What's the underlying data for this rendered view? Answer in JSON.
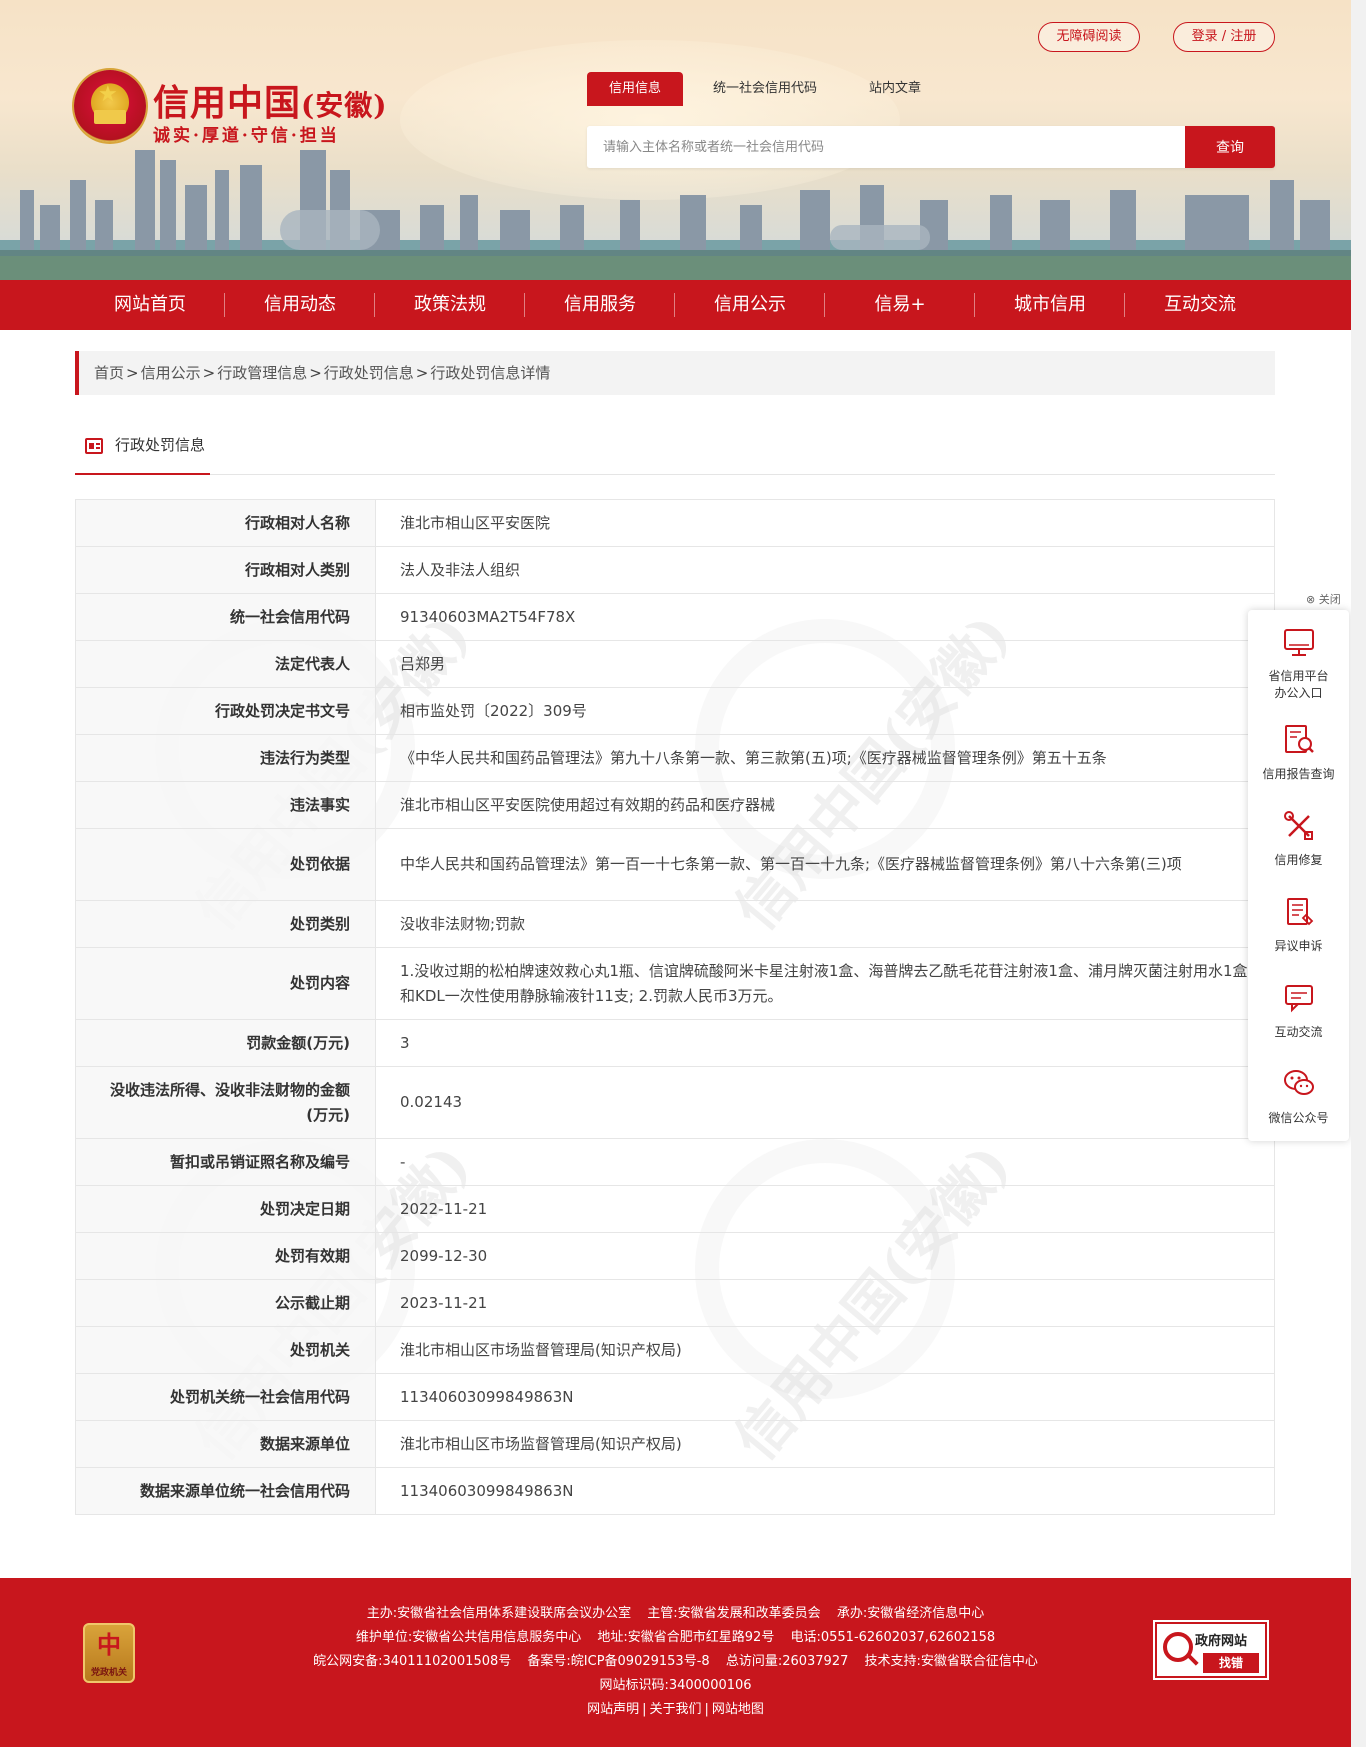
{
  "header": {
    "logo_title": "信用中国",
    "logo_province": "(安徽)",
    "logo_slogan": "诚实·厚道·守信·担当",
    "accessibility_label": "无障碍阅读",
    "login_label": "登录 / 注册",
    "search_tabs": [
      {
        "label": "信用信息",
        "active": true
      },
      {
        "label": "统一社会信用代码",
        "active": false
      },
      {
        "label": "站内文章",
        "active": false
      }
    ],
    "search_placeholder": "请输入主体名称或者统一社会信用代码",
    "search_button": "查询"
  },
  "nav": {
    "items": [
      "网站首页",
      "信用动态",
      "政策法规",
      "信用服务",
      "信用公示",
      "信易+",
      "城市信用",
      "互动交流"
    ]
  },
  "breadcrumb": {
    "items": [
      "首页",
      "信用公示",
      "行政管理信息",
      "行政处罚信息",
      "行政处罚信息详情"
    ],
    "separator": ">"
  },
  "section": {
    "title": "行政处罚信息"
  },
  "watermark": {
    "text": "信用中国(安徽)"
  },
  "detail_rows": [
    {
      "label": "行政相对人名称",
      "value": "淮北市相山区平安医院"
    },
    {
      "label": "行政相对人类别",
      "value": "法人及非法人组织"
    },
    {
      "label": "统一社会信用代码",
      "value": "91340603MA2T54F78X"
    },
    {
      "label": "法定代表人",
      "value": "吕郑男"
    },
    {
      "label": "行政处罚决定书文号",
      "value": "相市监处罚〔2022〕309号"
    },
    {
      "label": "违法行为类型",
      "value": "《中华人民共和国药品管理法》第九十八条第一款、第三款第(五)项;《医疗器械监督管理条例》第五十五条"
    },
    {
      "label": "违法事实",
      "value": "淮北市相山区平安医院使用超过有效期的药品和医疗器械"
    },
    {
      "label": "处罚依据",
      "value": "中华人民共和国药品管理法》第一百一十七条第一款、第一百一十九条;《医疗器械监督管理条例》第八十六条第(三)项"
    },
    {
      "label": "处罚类别",
      "value": "没收非法财物;罚款"
    },
    {
      "label": "处罚内容",
      "value": "1.没收过期的松柏牌速效救心丸1瓶、信谊牌硫酸阿米卡星注射液1盒、海普牌去乙酰毛花苷注射液1盒、浦月牌灭菌注射用水1盒和KDL一次性使用静脉输液针11支; 2.罚款人民币3万元。"
    },
    {
      "label": "罚款金额(万元)",
      "value": "3"
    },
    {
      "label": "没收违法所得、没收非法财物的金额(万元)",
      "value": "0.02143"
    },
    {
      "label": "暂扣或吊销证照名称及编号",
      "value": "-"
    },
    {
      "label": "处罚决定日期",
      "value": "2022-11-21"
    },
    {
      "label": "处罚有效期",
      "value": "2099-12-30"
    },
    {
      "label": "公示截止期",
      "value": "2023-11-21"
    },
    {
      "label": "处罚机关",
      "value": "淮北市相山区市场监督管理局(知识产权局)"
    },
    {
      "label": "处罚机关统一社会信用代码",
      "value": "11340603099849863N"
    },
    {
      "label": "数据来源单位",
      "value": "淮北市相山区市场监督管理局(知识产权局)"
    },
    {
      "label": "数据来源单位统一社会信用代码",
      "value": "11340603099849863N"
    }
  ],
  "side_panel": {
    "close_label": "⊗ 关闭",
    "items": [
      {
        "label": "省信用平台办公入口",
        "icon": "monitor-icon"
      },
      {
        "label": "信用报告查询",
        "icon": "report-search-icon"
      },
      {
        "label": "信用修复",
        "icon": "tools-icon"
      },
      {
        "label": "异议申诉",
        "icon": "appeal-document-icon"
      },
      {
        "label": "互动交流",
        "icon": "chat-icon"
      },
      {
        "label": "微信公众号",
        "icon": "wechat-icon"
      }
    ]
  },
  "footer": {
    "badge_text": "党政机关",
    "line1": [
      "主办:安徽省社会信用体系建设联席会议办公室",
      "主管:安徽省发展和改革委员会",
      "承办:安徽省经济信息中心"
    ],
    "line2": [
      "维护单位:安徽省公共信用信息服务中心",
      "地址:安徽省合肥市红星路92号",
      "电话:0551-62602037,62602158"
    ],
    "line3": [
      "皖公网安备:34011102001508号",
      "备案号:皖ICP备09029153号-8",
      "总访问量:26037927",
      "技术支持:安徽省联合征信中心"
    ],
    "line4": "网站标识码:3400000106",
    "links": [
      "网站声明",
      "关于我们",
      "网站地图"
    ],
    "gov_badge_title": "政府网站",
    "gov_badge_action": "找错"
  },
  "colors": {
    "brand_red": "#c8161d",
    "label_bg": "#f7f7f7",
    "breadcrumb_bg": "#f3f3f3"
  }
}
